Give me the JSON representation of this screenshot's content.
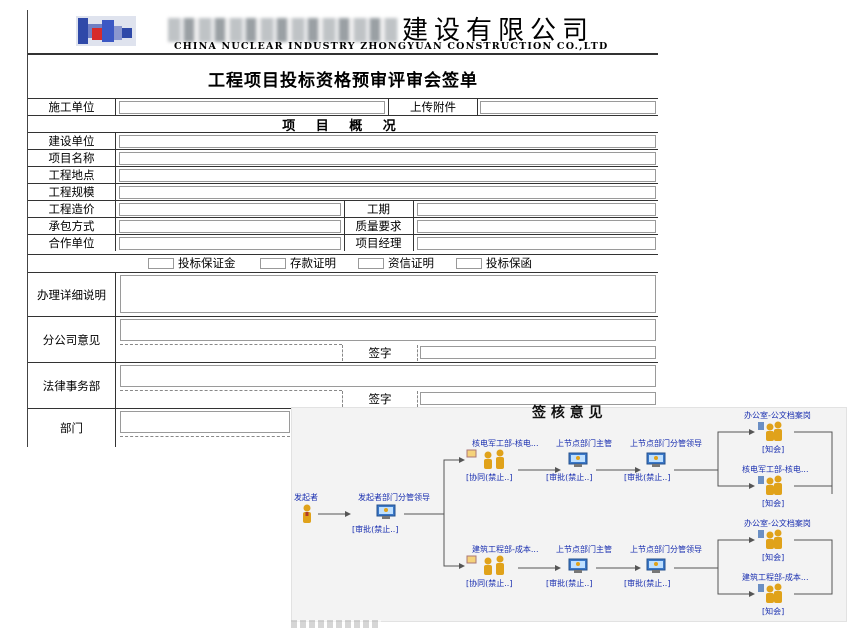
{
  "form": {
    "company_cn_suffix": "建设有限公司",
    "company_en": "CHINA NUCLEAR INDUSTRY ZHONGYUAN CONSTRUCTION CO.,LTD",
    "title": "工程项目投标资格预审评审会签单",
    "construction_unit_label": "施工单位",
    "upload_attachment_label": "上传附件",
    "overview_heading": "项 目 概 况",
    "owner_label": "建设单位",
    "project_name_label": "项目名称",
    "project_location_label": "工程地点",
    "project_scale_label": "工程规模",
    "project_cost_label": "工程造价",
    "duration_label": "工期",
    "contract_mode_label": "承包方式",
    "quality_label": "质量要求",
    "partner_label": "合作单位",
    "project_manager_label": "项目经理",
    "checks": [
      "投标保证金",
      "存款证明",
      "资信证明",
      "投标保函"
    ],
    "details_label": "办理详细说明",
    "branch_opinion_label": "分公司意见",
    "signature_label": "签字",
    "legal_label": "法律事务部",
    "dept_label": "部门"
  },
  "flow": {
    "title_fragment": "签 核 意 见",
    "start": {
      "label": "发起者"
    },
    "first": {
      "label": "发起者部门分管领导",
      "state": "[审批(禁止..]"
    },
    "top_branch": {
      "n1": {
        "label": "核电军工部-核电...",
        "state": "[协同(禁止..]"
      },
      "n2": {
        "label": "上节点部门主管",
        "state": "[审批(禁止..]"
      },
      "n3": {
        "label": "上节点部门分管领导",
        "state": "[审批(禁止..]"
      },
      "n4a": {
        "label": "办公室-公文档案岗",
        "state": "[知会]"
      },
      "n4b": {
        "label": "核电军工部-核电...",
        "state": "[知会]"
      }
    },
    "bottom_branch": {
      "n1": {
        "label": "建筑工程部-成本...",
        "state": "[协同(禁止..]"
      },
      "n2": {
        "label": "上节点部门主管",
        "state": "[审批(禁止..]"
      },
      "n3": {
        "label": "上节点部门分管领导",
        "state": "[审批(禁止..]"
      },
      "n4a": {
        "label": "办公室-公文档案岗",
        "state": "[知会]"
      },
      "n4b": {
        "label": "建筑工程部-成本...",
        "state": "[知会]"
      }
    },
    "colors": {
      "link": "#1a2fb0",
      "edge": "#555555",
      "person": "#e0a21a"
    }
  }
}
